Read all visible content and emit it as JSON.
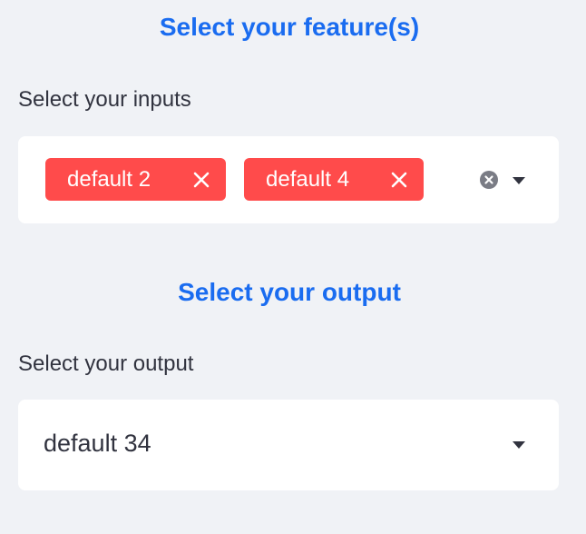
{
  "inputs_section": {
    "title": "Select your feature(s)",
    "label": "Select your inputs",
    "chips": [
      {
        "label": "default 2",
        "close_icon": "x-icon"
      },
      {
        "label": "default 4",
        "close_icon": "x-icon"
      }
    ],
    "clear_icon": "circle-x-icon",
    "dropdown_icon": "caret-down-icon"
  },
  "output_section": {
    "title": "Select your output",
    "label": "Select your output",
    "selected_value": "default 34",
    "dropdown_icon": "caret-down-icon"
  },
  "colors": {
    "accent": "#1a6cf0",
    "chip": "#ff4b4b",
    "background": "#f0f2f6",
    "surface": "#ffffff",
    "text": "#31333f"
  }
}
